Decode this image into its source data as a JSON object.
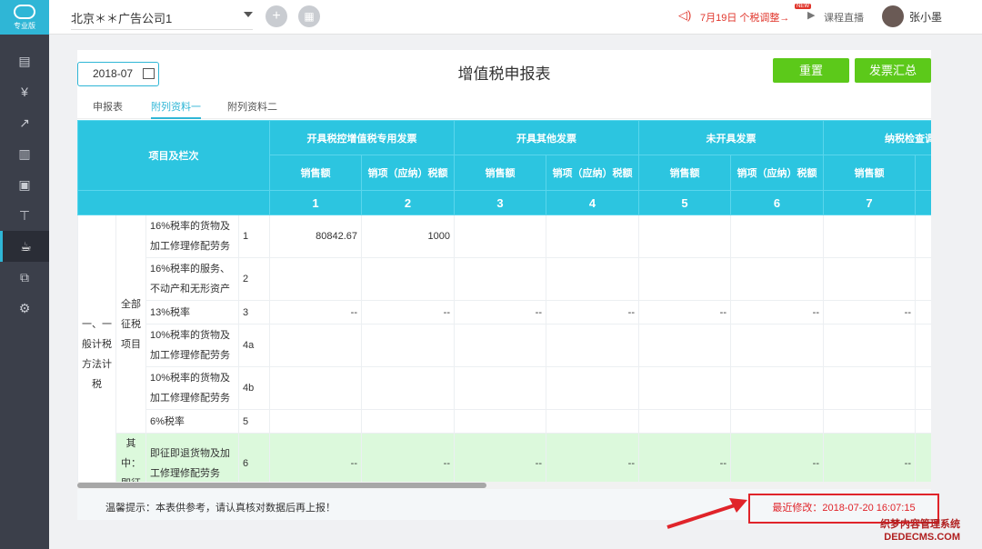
{
  "sidebar": {
    "logo_text": "专业版",
    "icons": [
      "doc-icon",
      "invoice-icon",
      "chart-icon",
      "report-icon",
      "archive-icon",
      "tool-icon",
      "tax-icon",
      "export-icon",
      "settings-icon"
    ]
  },
  "topbar": {
    "company": "北京＊＊广告公司1",
    "notice": "7月19日 个税调整→",
    "new_badge": "NEW",
    "live": "课程直播",
    "user_name": "张小墨"
  },
  "toolbar": {
    "period": "2018-07",
    "title": "增值税申报表",
    "reset_label": "重置",
    "summary_label": "发票汇总"
  },
  "tabs": [
    {
      "label": "申报表",
      "active": false
    },
    {
      "label": "附列资料一",
      "active": true
    },
    {
      "label": "附列资料二",
      "active": false
    }
  ],
  "table": {
    "header_main": "项目及栏次",
    "groups": [
      "开具税控增值税专用发票",
      "开具其他发票",
      "未开具发票",
      "纳税检查调"
    ],
    "subcols": [
      "销售额",
      "销项（应纳）税额",
      "销售额",
      "销项（应纳）税额",
      "销售额",
      "销项（应纳）税额",
      "销售额",
      "销"
    ],
    "colnums": [
      "1",
      "2",
      "3",
      "4",
      "5",
      "6",
      "7",
      ""
    ],
    "section": "一、一般计税方法计税",
    "subsection": "全部征税项目",
    "subsection2": "其中：即征",
    "rows": [
      {
        "desc": "16%税率的货物及加工修理修配劳务",
        "line": "1",
        "cells": [
          "80842.67",
          "1000",
          "",
          "",
          "",
          "",
          "",
          ""
        ]
      },
      {
        "desc": "16%税率的服务、不动产和无形资产",
        "line": "2",
        "cells": [
          "",
          "",
          "",
          "",
          "",
          "",
          "",
          ""
        ]
      },
      {
        "desc": "13%税率",
        "line": "3",
        "cells": [
          "--",
          "--",
          "--",
          "--",
          "--",
          "--",
          "--",
          ""
        ]
      },
      {
        "desc": "10%税率的货物及加工修理修配劳务",
        "line": "4a",
        "cells": [
          "",
          "",
          "",
          "",
          "",
          "",
          "",
          ""
        ]
      },
      {
        "desc": "10%税率的货物及加工修理修配劳务",
        "line": "4b",
        "cells": [
          "",
          "",
          "",
          "",
          "",
          "",
          "",
          ""
        ]
      },
      {
        "desc": "6%税率",
        "line": "5",
        "cells": [
          "",
          "",
          "",
          "",
          "",
          "",
          "",
          ""
        ]
      },
      {
        "desc": "即征即退货物及加工修理修配劳务",
        "line": "6",
        "cells": [
          "--",
          "--",
          "--",
          "--",
          "--",
          "--",
          "--",
          ""
        ]
      }
    ]
  },
  "footer": {
    "tip": "温馨提示：本表供参考，请认真核对数据后再上报！",
    "modified": "最近修改：2018-07-20 16:07:15"
  },
  "watermark": {
    "line1": "织梦内容管理系统",
    "line2": "DEDECMS.COM"
  }
}
